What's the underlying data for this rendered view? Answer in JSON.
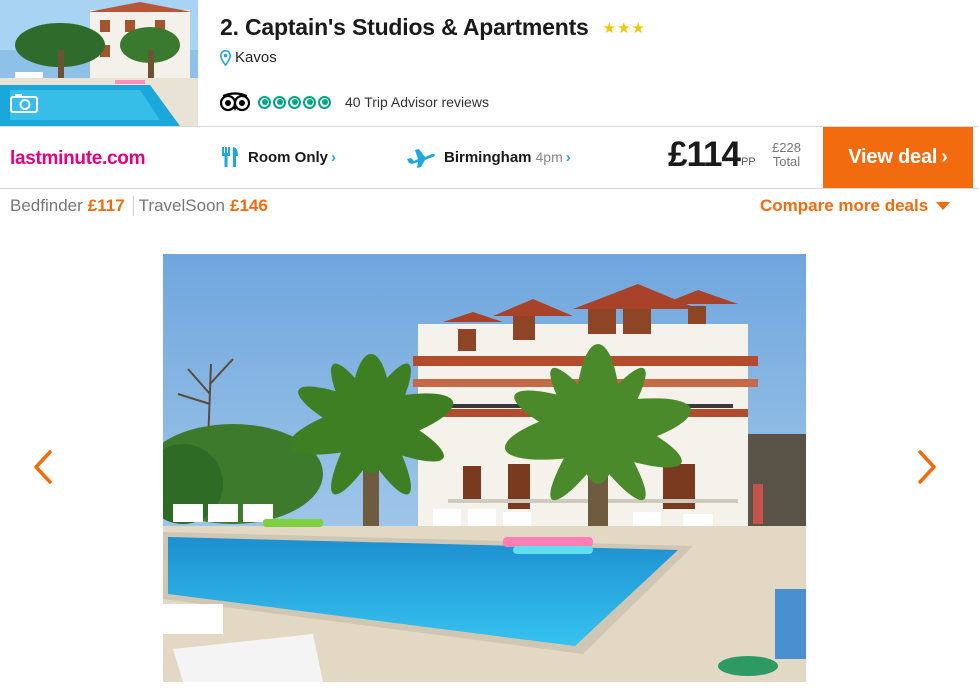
{
  "hotel": {
    "rank_title": "2. Captain's Studios & Apartments",
    "stars": "★★★",
    "location": "Kavos",
    "reviews_text": "40 Trip Advisor reviews",
    "rating_bubbles": 5
  },
  "deal": {
    "provider": "lastminute.com",
    "board": "Room Only",
    "departure_airport": "Birmingham",
    "departure_time": "4pm",
    "price": "£114",
    "price_unit": "PP",
    "total_price": "£228",
    "total_label": "Total",
    "view_deal_label": "View deal"
  },
  "more_deals": {
    "alternatives": [
      {
        "name": "Bedfinder",
        "price": "£117"
      },
      {
        "name": "TravelSoon",
        "price": "£146"
      }
    ],
    "compare_label": "Compare more deals"
  },
  "icons": {
    "chevron": "›",
    "arrow_left": "‹",
    "arrow_right": "›"
  },
  "colors": {
    "accent_orange": "#f26b0f",
    "provider_pink": "#e6007e",
    "tripadvisor_green": "#00a680",
    "link_blue": "#1fa7e0",
    "star_yellow": "#f5c600"
  }
}
